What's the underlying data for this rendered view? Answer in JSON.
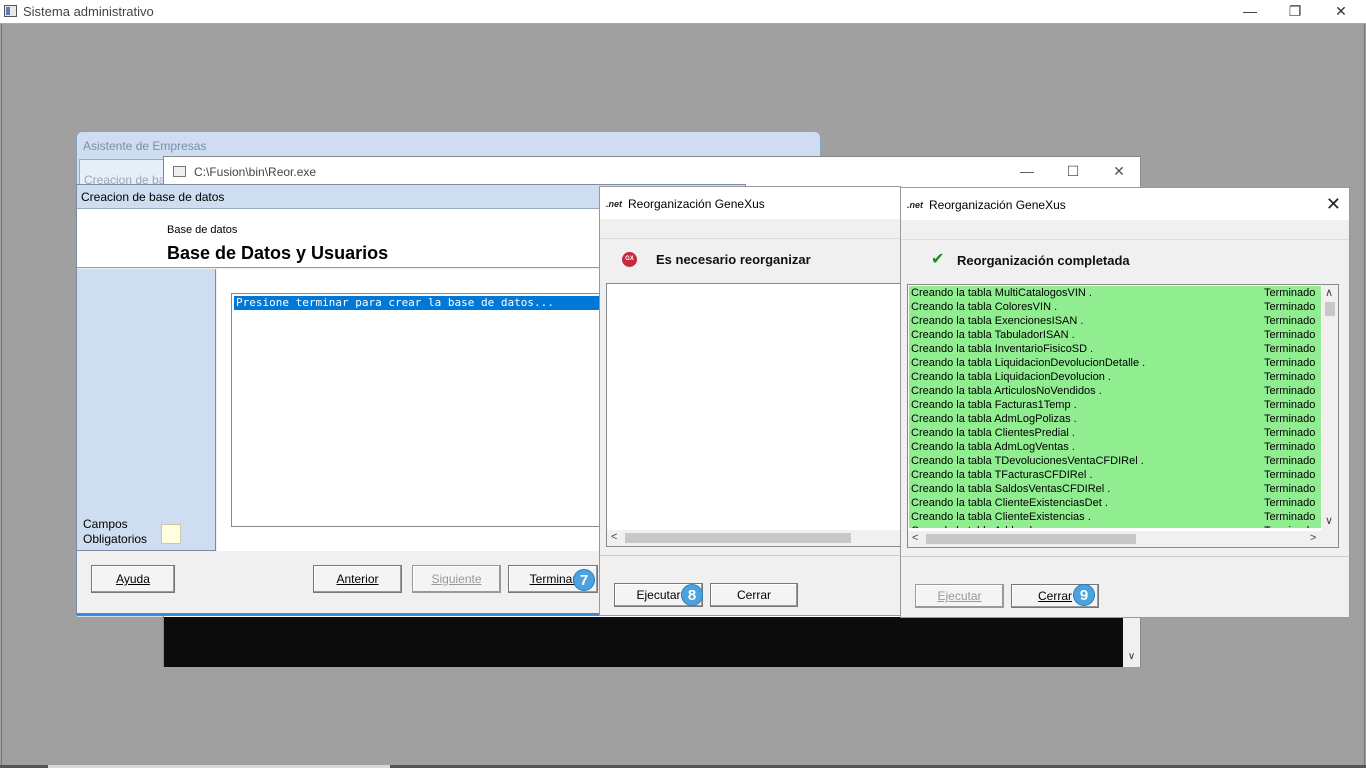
{
  "app": {
    "title": "Sistema administrativo",
    "min_glyph": "—",
    "restore_glyph": "❐",
    "close_glyph": "✕"
  },
  "asistente": {
    "title": "Asistente de Empresas",
    "sub_title": "Creacion de ba"
  },
  "reor_console": {
    "title": "C:\\Fusion\\bin\\Reor.exe",
    "min_glyph": "—",
    "max_glyph": "☐",
    "close_glyph": "✕",
    "down_arrow": "∨"
  },
  "wizard": {
    "title": "Creacion de base de datos",
    "header_small": "Base de datos",
    "header_big": "Base de Datos y Usuarios",
    "log_line": "Presione terminar para crear la base de datos...",
    "required_label_1": "Campos",
    "required_label_2": "Obligatorios",
    "buttons": {
      "help": "Ayuda",
      "prev": "Anterior",
      "next": "Siguiente",
      "finish": "Terminar"
    },
    "step_badge": "7"
  },
  "reorg_left": {
    "net_label": ".net",
    "title": "Reorganización GeneXus",
    "icon_text": "GX",
    "status": "Es necesario reorganizar",
    "buttons": {
      "run": "Ejecutar",
      "close": "Cerrar"
    },
    "step_badge": "8",
    "left_arrow": "<"
  },
  "reorg_right": {
    "net_label": ".net",
    "title": "Reorganización GeneXus",
    "close_glyph": "✕",
    "check_glyph": "✔",
    "status": "Reorganización completada",
    "buttons": {
      "run": "Ejecutar",
      "close": "Cerrar"
    },
    "step_badge": "9",
    "up_arrow": "∧",
    "down_arrow": "∨",
    "left_arrow": "<",
    "right_arrow": ">",
    "rows": [
      {
        "name": "Creando la tabla MultiCatalogosVIN .",
        "status": "Terminado"
      },
      {
        "name": "Creando la tabla ColoresVIN .",
        "status": "Terminado"
      },
      {
        "name": "Creando la tabla ExencionesISAN .",
        "status": "Terminado"
      },
      {
        "name": "Creando la tabla TabuladorISAN .",
        "status": "Terminado"
      },
      {
        "name": "Creando la tabla InventarioFisicoSD .",
        "status": "Terminado"
      },
      {
        "name": "Creando la tabla LiquidacionDevolucionDetalle .",
        "status": "Terminado"
      },
      {
        "name": "Creando la tabla LiquidacionDevolucion .",
        "status": "Terminado"
      },
      {
        "name": "Creando la tabla ArticulosNoVendidos .",
        "status": "Terminado"
      },
      {
        "name": "Creando la tabla Facturas1Temp .",
        "status": "Terminado"
      },
      {
        "name": "Creando la tabla AdmLogPolizas .",
        "status": "Terminado"
      },
      {
        "name": "Creando la tabla ClientesPredial .",
        "status": "Terminado"
      },
      {
        "name": "Creando la tabla AdmLogVentas .",
        "status": "Terminado"
      },
      {
        "name": "Creando la tabla TDevolucionesVentaCFDIRel .",
        "status": "Terminado"
      },
      {
        "name": "Creando la tabla TFacturasCFDIRel .",
        "status": "Terminado"
      },
      {
        "name": "Creando la tabla SaldosVentasCFDIRel .",
        "status": "Terminado"
      },
      {
        "name": "Creando la tabla ClienteExistenciasDet .",
        "status": "Terminado"
      },
      {
        "name": "Creando la tabla ClienteExistencias .",
        "status": "Terminado"
      },
      {
        "name": "Creando la tabla Addenda .",
        "status": "Terminado"
      }
    ]
  },
  "colors": {
    "log_background": "#90ee90",
    "selection": "#0078d7",
    "badge": "#4aa3df",
    "wizard_panel": "#cfddf0"
  }
}
